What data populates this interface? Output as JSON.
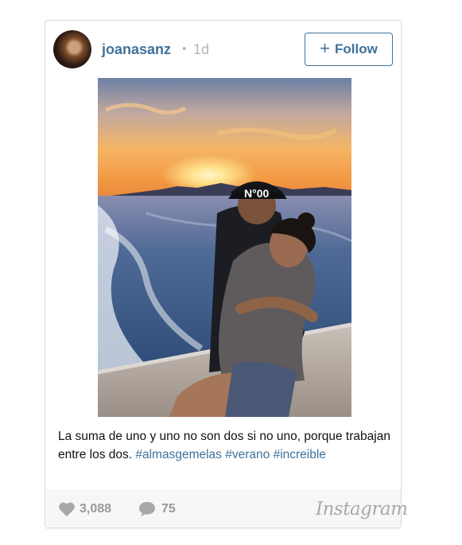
{
  "post": {
    "username": "joanasanz",
    "separator": "•",
    "time_ago": "1d",
    "follow_label": "Follow",
    "follow_icon": "plus-icon",
    "image": {
      "cap_text": "N°00",
      "colors": {
        "sky_top": "#6c7fa4",
        "sunset": "#f6a54c",
        "sun": "#ffe79a",
        "sea": "#2d4c78"
      }
    },
    "caption": {
      "text": "La suma de uno y uno no son dos si no uno, porque trabajan entre los dos.",
      "hashtags": [
        "#almasgemelas",
        "#verano",
        "#increible"
      ]
    }
  },
  "footer": {
    "like_icon": "heart-icon",
    "likes": "3,088",
    "comment_icon": "comment-bubble-icon",
    "comments": "75",
    "brand": "Instagram"
  },
  "colors": {
    "accent": "#3f729b",
    "muted": "#999999",
    "footer_bg": "#f7f7f7"
  }
}
